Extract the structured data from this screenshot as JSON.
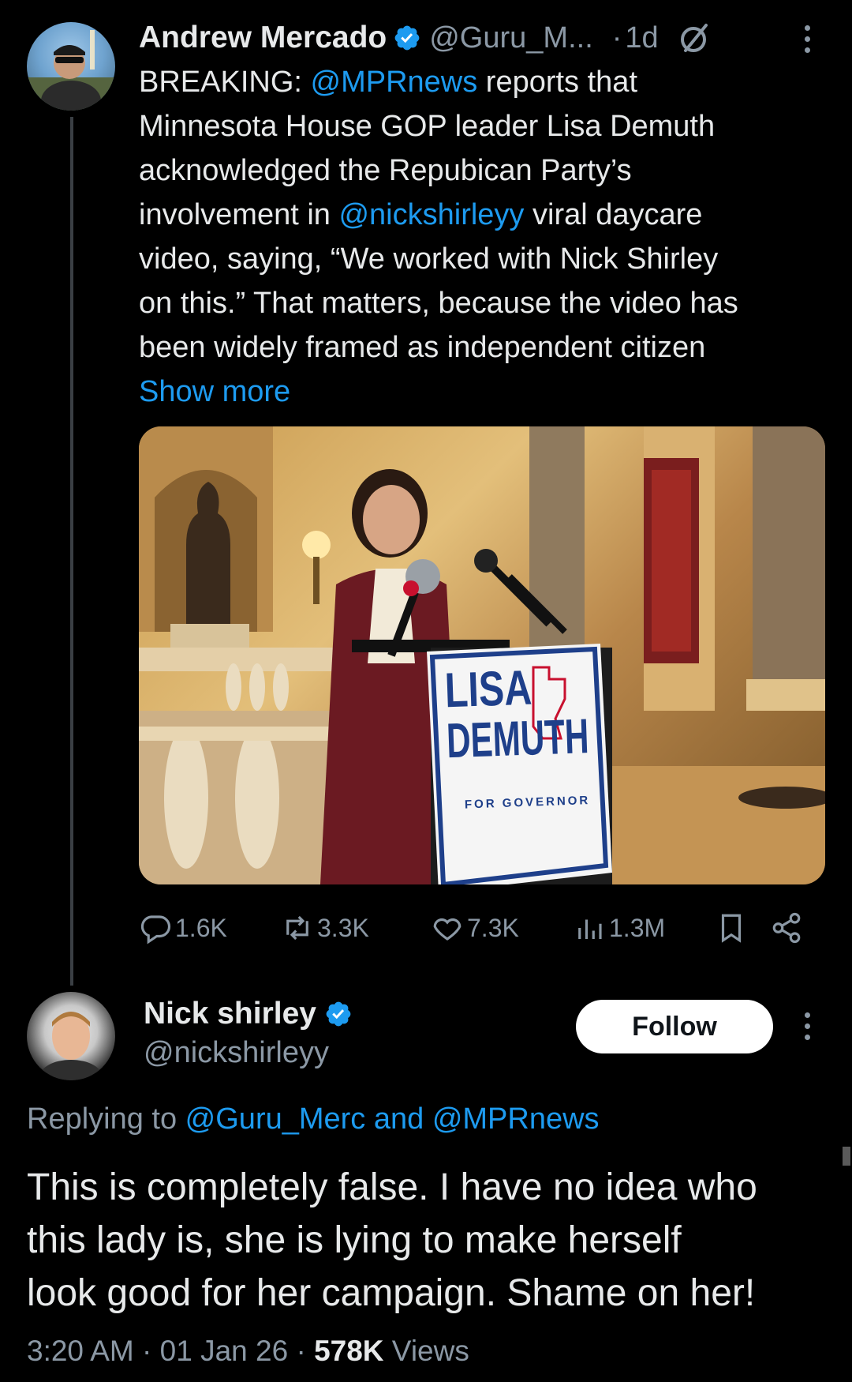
{
  "tweet": {
    "author_name": "Andrew Mercado",
    "author_handle": "@Guru_M...",
    "separator": "·",
    "time_ago": "1d",
    "text_line1_prefix": "BREAKING: ",
    "text_line1_mention": "@MPRnews",
    "text_line1_suffix": " reports that",
    "text_line2": "Minnesota House GOP leader Lisa Demuth",
    "text_line3": "acknowledged the Repubican Party’s",
    "text_line4_prefix": "involvement in ",
    "text_line4_mention": "@nickshirleyy",
    "text_line4_suffix": " viral daycare",
    "text_line5": "video, saying, “We worked with Nick Shirley",
    "text_line6": "on this.” That matters, because the video has",
    "text_line7": "been widely framed as independent citizen",
    "show_more": "Show more",
    "image_sign": {
      "line1": "LISA",
      "line2": "DEMUTH",
      "line3": "FOR GOVERNOR"
    },
    "stats": {
      "replies": "1.6K",
      "reposts": "3.3K",
      "likes": "7.3K",
      "views": "1.3M"
    }
  },
  "reply": {
    "author_name": "Nick shirley",
    "author_handle": "@nickshirleyy",
    "follow_label": "Follow",
    "replying_to_label": "Replying to ",
    "replying_to_users": "@Guru_Merc and @MPRnews",
    "text_line1": "This is completely false. I have no idea who",
    "text_line2": "this lady is, she is lying to make herself",
    "text_line3": "look good for her campaign. Shame on her!",
    "time": "3:20 AM",
    "dot": " · ",
    "date": "01 Jan 26",
    "views_count": "578K",
    "views_label": " Views"
  },
  "colors": {
    "background": "#000000",
    "text": "#e7e9ea",
    "secondary": "#8b98a5",
    "link": "#1d9bf0",
    "verified": "#1d9bf0"
  }
}
